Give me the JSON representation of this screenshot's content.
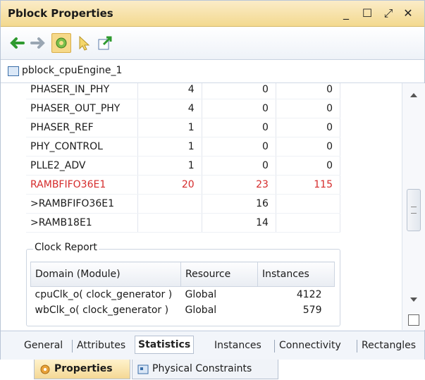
{
  "window": {
    "title": "Pblock Properties",
    "minimize": "_",
    "maximize": "☐",
    "float": "⤢",
    "close": "✕"
  },
  "toolbar": {
    "back_icon": "back-arrow-icon",
    "forward_icon": "forward-arrow-icon",
    "auto_icon": "auto-update-icon",
    "select_icon": "select-cursor-icon",
    "export_icon": "export-icon"
  },
  "object": {
    "name": "pblock_cpuEngine_1"
  },
  "resources": [
    {
      "name": "PHASER_IN_PHY",
      "c1": "4",
      "c2": "0",
      "c3": "0",
      "red": false
    },
    {
      "name": "PHASER_OUT_PHY",
      "c1": "4",
      "c2": "0",
      "c3": "0",
      "red": false
    },
    {
      "name": "PHASER_REF",
      "c1": "1",
      "c2": "0",
      "c3": "0",
      "red": false
    },
    {
      "name": "PHY_CONTROL",
      "c1": "1",
      "c2": "0",
      "c3": "0",
      "red": false
    },
    {
      "name": "PLLE2_ADV",
      "c1": "1",
      "c2": "0",
      "c3": "0",
      "red": false
    },
    {
      "name": "RAMBFIFO36E1",
      "c1": "20",
      "c2": "23",
      "c3": "115",
      "red": true
    },
    {
      "name": ">RAMBFIFO36E1",
      "c1": "",
      "c2": "16",
      "c3": "",
      "red": false
    },
    {
      "name": ">RAMB18E1",
      "c1": "",
      "c2": "14",
      "c3": "",
      "red": false
    }
  ],
  "clock_report": {
    "title": "Clock Report",
    "headers": {
      "domain": "Domain (Module)",
      "resource": "Resource",
      "instances": "Instances"
    },
    "rows": [
      {
        "domain": "cpuClk_o( clock_generator )",
        "resource": "Global",
        "instances": "4122"
      },
      {
        "domain": "wbClk_o( clock_generator )",
        "resource": "Global",
        "instances": "579"
      }
    ]
  },
  "tabs": [
    "General",
    "Attributes",
    "Statistics",
    "Instances",
    "Connectivity",
    "Rectangles"
  ],
  "selected_tab": "Statistics",
  "bottom_tabs": {
    "properties": "Properties",
    "physical": "Physical Constraints"
  },
  "colors": {
    "accent": "#f6d98a",
    "error_red": "#d52b2b"
  }
}
